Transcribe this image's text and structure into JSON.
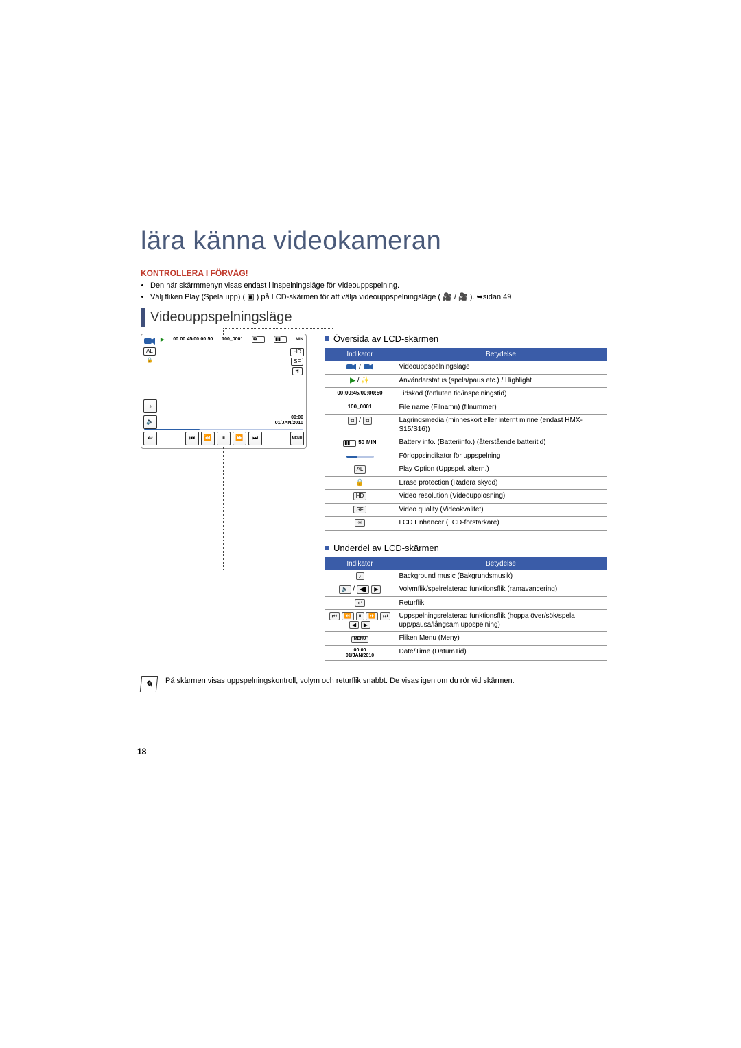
{
  "page_number": "18",
  "title": "lära känna videokameran",
  "precheck": {
    "heading": "KONTROLLERA I FÖRVÄG!",
    "items": [
      "Den här skärmmenyn visas endast i inspelningsläge för Videouppspelning.",
      "Välj fliken Play (Spela upp) ( ▣ ) på LCD-skärmen för att välja videouppspelningsläge ( 🎥 / 🎥 ). ➥sidan 49"
    ]
  },
  "mode_heading": "Videouppspelningsläge",
  "chart_data": {
    "timecode": "00:00:45/00:00:50",
    "file_label": "100_0001",
    "time": "00:00",
    "date": "01/JAN/2010",
    "min_label": "MIN",
    "battery_text": "50"
  },
  "upper": {
    "heading": "Översida av LCD-skärmen",
    "col1": "Indikator",
    "col2": "Betydelse",
    "rows": [
      {
        "ind": "🎥 / 🎥",
        "mean": "Videouppspelningsläge"
      },
      {
        "ind": "▶ / ✨",
        "mean": "Användarstatus (spela/paus etc.) / Highlight"
      },
      {
        "ind": "00:00:45/00:00:50",
        "mean": "Tidskod (förfluten tid/inspelningstid)"
      },
      {
        "ind": "100_0001",
        "mean": "File name (Filnamn) (filnummer)"
      },
      {
        "ind": "⧉ / ⧉",
        "mean": "Lagringsmedia (minneskort eller internt minne (endast HMX-S15/S16))"
      },
      {
        "ind": "▮▮ 50 MIN",
        "mean": "Battery info. (Batteriinfo.) (återstående batteritid)"
      },
      {
        "ind": "───",
        "mean": "Förloppsindikator för uppspelning"
      },
      {
        "ind": "ALL",
        "mean": "Play Option (Uppspel. altern.)"
      },
      {
        "ind": "🔒",
        "mean": "Erase protection (Radera skydd)"
      },
      {
        "ind": "HD",
        "mean": "Video resolution (Videoupplösning)"
      },
      {
        "ind": "SF",
        "mean": "Video quality (Videokvalitet)"
      },
      {
        "ind": "☀",
        "mean": "LCD Enhancer (LCD-förstärkare)"
      }
    ]
  },
  "lower": {
    "heading": "Underdel av LCD-skärmen",
    "col1": "Indikator",
    "col2": "Betydelse",
    "rows": [
      {
        "ind": "♪",
        "mean": "Background music (Bakgrundsmusik)"
      },
      {
        "ind": "🔈 / ◀▮ ▶",
        "mean": "Volymflik/spelrelaterad funktionsflik (ramavancering)"
      },
      {
        "ind": "↩",
        "mean": "Returflik"
      },
      {
        "ind": "⏮ ⏪ ⏸ ⏩ ⏭  ◀ ▶",
        "mean": "Uppspelningsrelaterad funktionsflik (hoppa över/sök/spela upp/pausa/långsam uppspelning)"
      },
      {
        "ind": "MENU",
        "mean": "Fliken Menu (Meny)"
      },
      {
        "ind": "00:00 01/JAN/2010",
        "mean": "Date/Time (DatumTid)"
      }
    ]
  },
  "note": "På skärmen visas uppspelningskontroll, volym och returflik snabbt. De visas igen om du rör vid skärmen."
}
